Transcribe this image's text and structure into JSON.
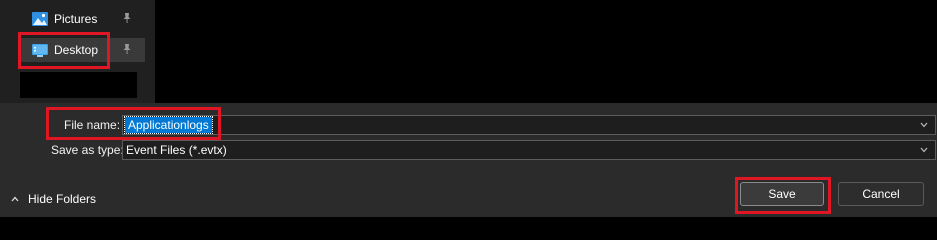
{
  "nav": {
    "items": [
      {
        "label": "Pictures",
        "icon": "pictures-icon",
        "pinned": true
      },
      {
        "label": "Desktop",
        "icon": "desktop-icon",
        "pinned": true,
        "selected": true
      }
    ]
  },
  "form": {
    "file_name": {
      "label": "File name:",
      "value": "Applicationlogs"
    },
    "save_as_type": {
      "label": "Save as type:",
      "value": "Event Files (*.evtx)"
    }
  },
  "footer": {
    "hide_folders_label": "Hide Folders",
    "save_label": "Save",
    "cancel_label": "Cancel"
  },
  "colors": {
    "highlight": "#e01624",
    "selection": "#0078d4",
    "panel": "#2b2b2b"
  }
}
